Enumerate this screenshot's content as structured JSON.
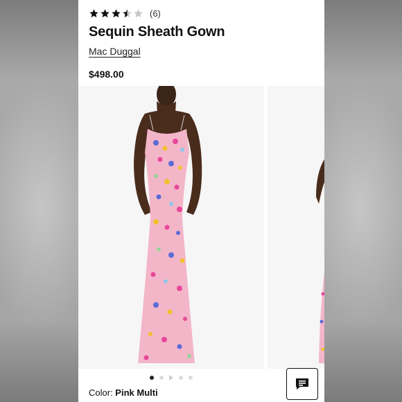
{
  "product": {
    "rating": 3.5,
    "review_count": "(6)",
    "title": "Sequin Sheath Gown",
    "brand": "Mac Duggal",
    "price": "$498.00",
    "color_label": "Color:",
    "color_value": "Pink Multi"
  },
  "gallery": {
    "slide_count": 5,
    "active_index": 0
  },
  "icons": {
    "star": "star-icon",
    "chat": "chat-icon",
    "play": "play-icon"
  },
  "colors": {
    "dress_base": "#f3b6c9",
    "star_fill": "#111111",
    "star_empty": "#c8c8c8"
  }
}
